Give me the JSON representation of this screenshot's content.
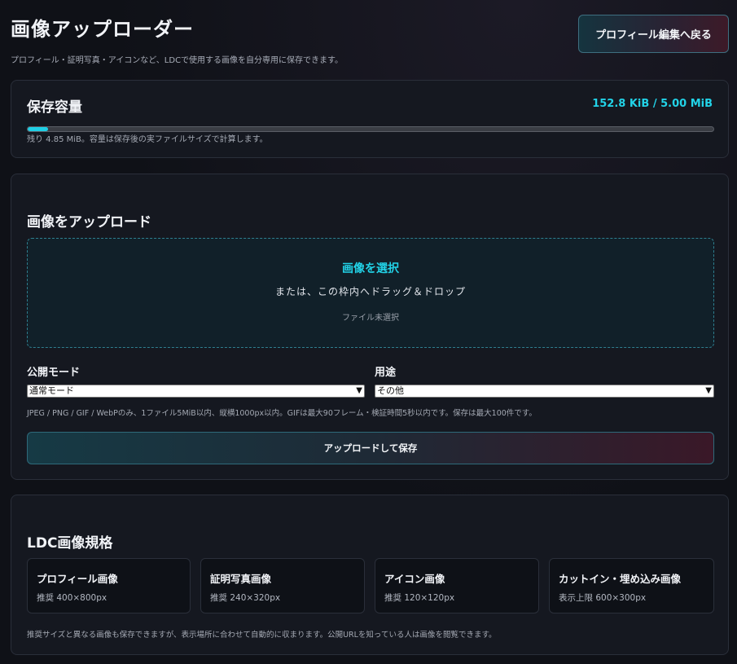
{
  "header": {
    "title": "画像アップローダー",
    "subtitle": "プロフィール・証明写真・アイコンなど、LDCで使用する画像を自分専用に保存できます。",
    "back_label": "プロフィール編集へ戻る"
  },
  "storage": {
    "heading": "保存容量",
    "usage": "152.8 KiB / 5.00 MiB",
    "used_fraction": 0.03,
    "note": "残り 4.85 MiB。容量は保存後の実ファイルサイズで計算します。"
  },
  "upload": {
    "heading": "画像をアップロード",
    "select_label": "画像を選択",
    "drop_hint": "または、この枠内へドラッグ＆ドロップ",
    "file_status": "ファイル未選択",
    "mode_label": "公開モード",
    "mode_value": "通常モード",
    "purpose_label": "用途",
    "purpose_value": "その他",
    "note": "JPEG / PNG / GIF / WebPのみ、1ファイル5MiB以内、縦横1000px以内。GIFは最大90フレーム・検証時間5秒以内です。保存は最大100件です。",
    "submit_label": "アップロードして保存"
  },
  "specs": {
    "heading": "LDC画像規格",
    "cards": [
      {
        "title": "プロフィール画像",
        "size": "推奨 400×800px"
      },
      {
        "title": "証明写真画像",
        "size": "推奨 240×320px"
      },
      {
        "title": "アイコン画像",
        "size": "推奨 120×120px"
      },
      {
        "title": "カットイン・埋め込み画像",
        "size": "表示上限 600×300px"
      }
    ],
    "note": "推奨サイズと異なる画像も保存できますが、表示場所に合わせて自動的に収まります。公開URLを知っている人は画像を閲覧できます。"
  },
  "colors": {
    "accent": "#22d3e8",
    "background": "#0f1117",
    "panel": "#151820"
  }
}
